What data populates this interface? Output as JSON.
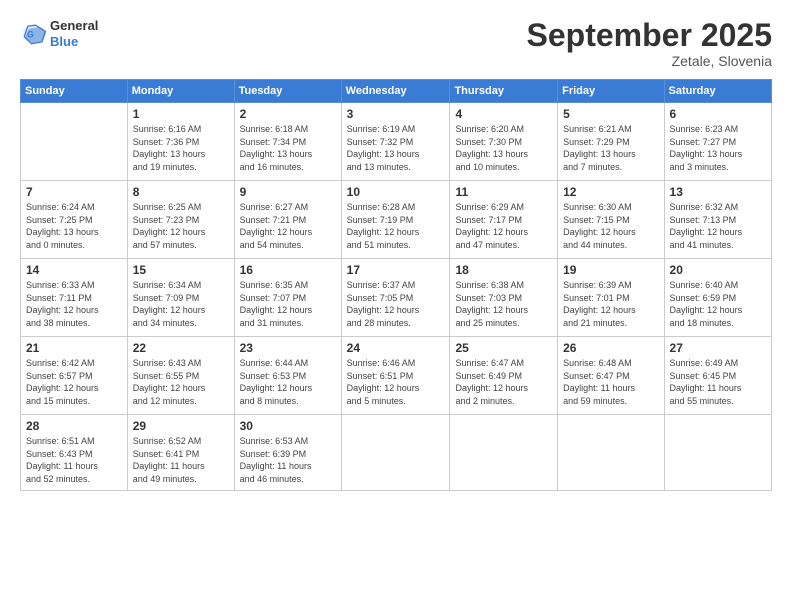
{
  "header": {
    "logo": {
      "general": "General",
      "blue": "Blue"
    },
    "title": "September 2025",
    "subtitle": "Zetale, Slovenia"
  },
  "weekdays": [
    "Sunday",
    "Monday",
    "Tuesday",
    "Wednesday",
    "Thursday",
    "Friday",
    "Saturday"
  ],
  "weeks": [
    [
      {
        "day": "",
        "info": ""
      },
      {
        "day": "1",
        "info": "Sunrise: 6:16 AM\nSunset: 7:36 PM\nDaylight: 13 hours\nand 19 minutes."
      },
      {
        "day": "2",
        "info": "Sunrise: 6:18 AM\nSunset: 7:34 PM\nDaylight: 13 hours\nand 16 minutes."
      },
      {
        "day": "3",
        "info": "Sunrise: 6:19 AM\nSunset: 7:32 PM\nDaylight: 13 hours\nand 13 minutes."
      },
      {
        "day": "4",
        "info": "Sunrise: 6:20 AM\nSunset: 7:30 PM\nDaylight: 13 hours\nand 10 minutes."
      },
      {
        "day": "5",
        "info": "Sunrise: 6:21 AM\nSunset: 7:29 PM\nDaylight: 13 hours\nand 7 minutes."
      },
      {
        "day": "6",
        "info": "Sunrise: 6:23 AM\nSunset: 7:27 PM\nDaylight: 13 hours\nand 3 minutes."
      }
    ],
    [
      {
        "day": "7",
        "info": "Sunrise: 6:24 AM\nSunset: 7:25 PM\nDaylight: 13 hours\nand 0 minutes."
      },
      {
        "day": "8",
        "info": "Sunrise: 6:25 AM\nSunset: 7:23 PM\nDaylight: 12 hours\nand 57 minutes."
      },
      {
        "day": "9",
        "info": "Sunrise: 6:27 AM\nSunset: 7:21 PM\nDaylight: 12 hours\nand 54 minutes."
      },
      {
        "day": "10",
        "info": "Sunrise: 6:28 AM\nSunset: 7:19 PM\nDaylight: 12 hours\nand 51 minutes."
      },
      {
        "day": "11",
        "info": "Sunrise: 6:29 AM\nSunset: 7:17 PM\nDaylight: 12 hours\nand 47 minutes."
      },
      {
        "day": "12",
        "info": "Sunrise: 6:30 AM\nSunset: 7:15 PM\nDaylight: 12 hours\nand 44 minutes."
      },
      {
        "day": "13",
        "info": "Sunrise: 6:32 AM\nSunset: 7:13 PM\nDaylight: 12 hours\nand 41 minutes."
      }
    ],
    [
      {
        "day": "14",
        "info": "Sunrise: 6:33 AM\nSunset: 7:11 PM\nDaylight: 12 hours\nand 38 minutes."
      },
      {
        "day": "15",
        "info": "Sunrise: 6:34 AM\nSunset: 7:09 PM\nDaylight: 12 hours\nand 34 minutes."
      },
      {
        "day": "16",
        "info": "Sunrise: 6:35 AM\nSunset: 7:07 PM\nDaylight: 12 hours\nand 31 minutes."
      },
      {
        "day": "17",
        "info": "Sunrise: 6:37 AM\nSunset: 7:05 PM\nDaylight: 12 hours\nand 28 minutes."
      },
      {
        "day": "18",
        "info": "Sunrise: 6:38 AM\nSunset: 7:03 PM\nDaylight: 12 hours\nand 25 minutes."
      },
      {
        "day": "19",
        "info": "Sunrise: 6:39 AM\nSunset: 7:01 PM\nDaylight: 12 hours\nand 21 minutes."
      },
      {
        "day": "20",
        "info": "Sunrise: 6:40 AM\nSunset: 6:59 PM\nDaylight: 12 hours\nand 18 minutes."
      }
    ],
    [
      {
        "day": "21",
        "info": "Sunrise: 6:42 AM\nSunset: 6:57 PM\nDaylight: 12 hours\nand 15 minutes."
      },
      {
        "day": "22",
        "info": "Sunrise: 6:43 AM\nSunset: 6:55 PM\nDaylight: 12 hours\nand 12 minutes."
      },
      {
        "day": "23",
        "info": "Sunrise: 6:44 AM\nSunset: 6:53 PM\nDaylight: 12 hours\nand 8 minutes."
      },
      {
        "day": "24",
        "info": "Sunrise: 6:46 AM\nSunset: 6:51 PM\nDaylight: 12 hours\nand 5 minutes."
      },
      {
        "day": "25",
        "info": "Sunrise: 6:47 AM\nSunset: 6:49 PM\nDaylight: 12 hours\nand 2 minutes."
      },
      {
        "day": "26",
        "info": "Sunrise: 6:48 AM\nSunset: 6:47 PM\nDaylight: 11 hours\nand 59 minutes."
      },
      {
        "day": "27",
        "info": "Sunrise: 6:49 AM\nSunset: 6:45 PM\nDaylight: 11 hours\nand 55 minutes."
      }
    ],
    [
      {
        "day": "28",
        "info": "Sunrise: 6:51 AM\nSunset: 6:43 PM\nDaylight: 11 hours\nand 52 minutes."
      },
      {
        "day": "29",
        "info": "Sunrise: 6:52 AM\nSunset: 6:41 PM\nDaylight: 11 hours\nand 49 minutes."
      },
      {
        "day": "30",
        "info": "Sunrise: 6:53 AM\nSunset: 6:39 PM\nDaylight: 11 hours\nand 46 minutes."
      },
      {
        "day": "",
        "info": ""
      },
      {
        "day": "",
        "info": ""
      },
      {
        "day": "",
        "info": ""
      },
      {
        "day": "",
        "info": ""
      }
    ]
  ]
}
